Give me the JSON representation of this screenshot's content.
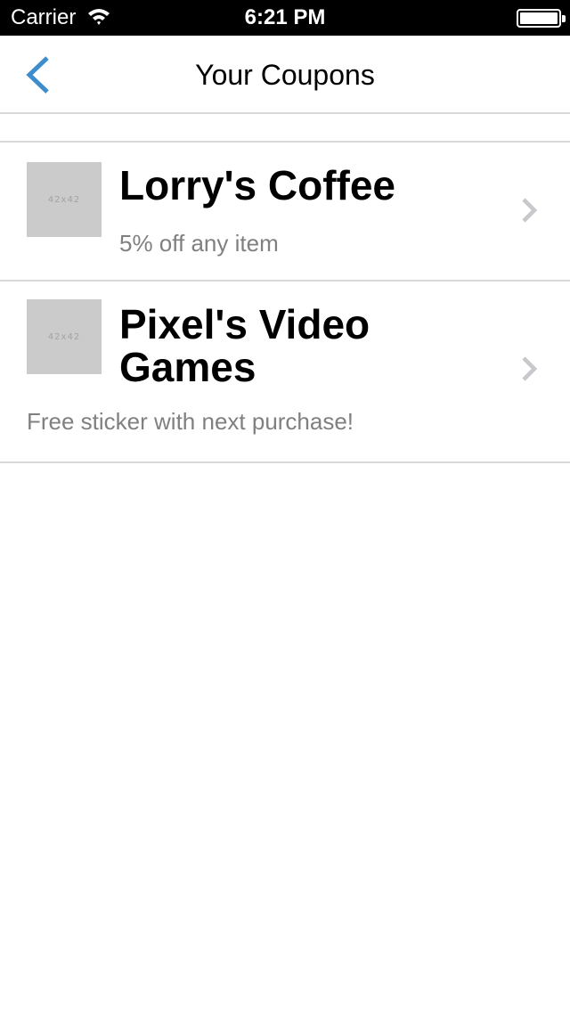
{
  "status_bar": {
    "carrier": "Carrier",
    "time": "6:21 PM",
    "wifi_icon": "wifi-icon",
    "battery_icon": "battery-icon"
  },
  "nav": {
    "title": "Your Coupons",
    "back_icon": "chevron-left-icon",
    "accent_color": "#3d8ccc"
  },
  "coupons": [
    {
      "name": "Lorry's Coffee",
      "detail": "5% off any item",
      "thumbnail_label": "42x42",
      "chevron_icon": "chevron-right-icon"
    },
    {
      "name": "Pixel's Video Games",
      "detail": "Free sticker with next purchase!",
      "thumbnail_label": "42x42",
      "chevron_icon": "chevron-right-icon"
    }
  ]
}
